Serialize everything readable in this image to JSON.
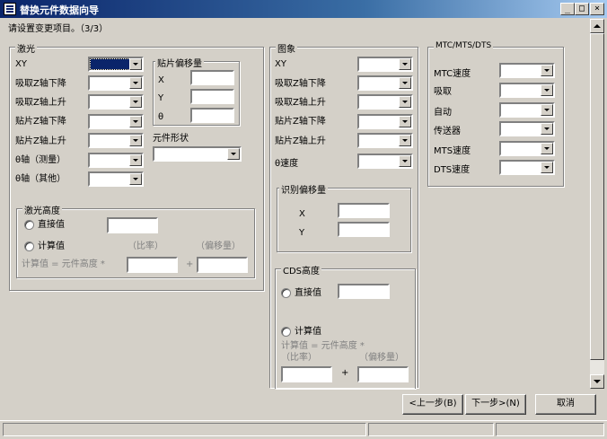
{
  "window": {
    "title": "替换元件数据向导",
    "min_label": "_",
    "max_label": "□",
    "close_label": "×"
  },
  "instruction": "请设置变更项目。（3/3）",
  "laser": {
    "group_label": "激光",
    "rows": [
      "XY",
      "吸取Z轴下降",
      "吸取Z轴上升",
      "贴片Z轴下降",
      "贴片Z轴上升",
      "θ轴（测量）",
      "θ轴（其他）"
    ],
    "offset": {
      "label": "贴片偏移量",
      "x": "X",
      "y": "Y",
      "theta": "θ"
    },
    "shape_label": "元件形状",
    "height": {
      "label": "激光高度",
      "direct": "直接值",
      "calculated": "计算值",
      "ratio_label": "（比率）",
      "offset_label": "（偏移量）",
      "formula": "计算值 = 元件高度 *",
      "plus": "+"
    }
  },
  "image": {
    "group_label": "图象",
    "rows": [
      "XY",
      "吸取Z轴下降",
      "吸取Z轴上升",
      "贴片Z轴下降",
      "贴片Z轴上升",
      "θ速度"
    ],
    "recog": {
      "label": "识别偏移量",
      "x": "X",
      "y": "Y"
    },
    "cds": {
      "label": "CDS高度",
      "direct": "直接值",
      "calculated": "计算值",
      "formula": "计算值 = 元件高度 *",
      "ratio_label": "（比率）",
      "offset_label": "（偏移量）",
      "plus": "+"
    }
  },
  "mtc": {
    "group_label": "MTC/MTS/DTS",
    "rows": [
      "MTC速度",
      "吸取",
      "自动",
      "传送器",
      "MTS速度",
      "DTS速度"
    ]
  },
  "buttons": {
    "back": "<上一步(B)",
    "next": "下一步>(N)",
    "cancel": "取消"
  },
  "colors": {
    "title_start": "#0a246a",
    "title_end": "#a6caf0",
    "face": "#d4d0c8",
    "selection": "#0a246a"
  }
}
